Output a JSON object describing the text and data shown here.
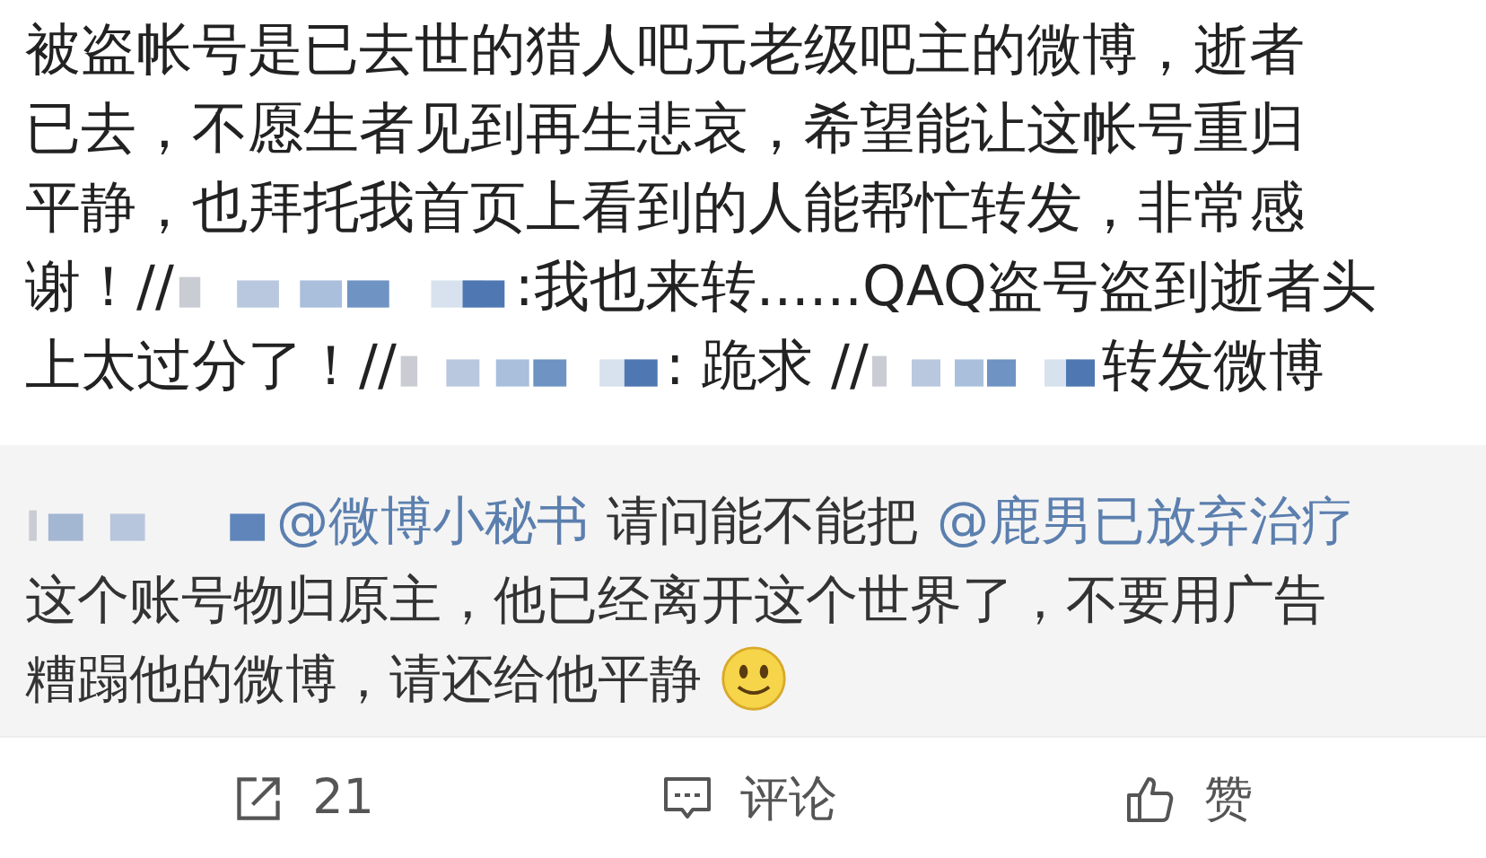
{
  "post": {
    "lines": [
      [
        {
          "kind": "text",
          "text": "被盗帐号是已去世的猎人吧元老级吧主的微博，逝者"
        }
      ],
      [
        {
          "kind": "text",
          "text": "已去，不愿生者见到再生悲哀，希望能让这帐号重归"
        }
      ],
      [
        {
          "kind": "text",
          "text": "平静，也拜托我首页上看到的人能帮忙转发，非常感"
        }
      ],
      [
        {
          "kind": "text",
          "text": "谢！//"
        },
        {
          "kind": "mosaic"
        },
        {
          "kind": "text",
          "text": ":我也来转......QAQ盗号盗到逝者头"
        }
      ],
      [
        {
          "kind": "text",
          "text": "上太过分了！//"
        },
        {
          "kind": "mosaic"
        },
        {
          "kind": "text",
          "text": ": 跪求 //"
        },
        {
          "kind": "mosaic"
        },
        {
          "kind": "text",
          "text": "转发微博"
        }
      ]
    ]
  },
  "comment": {
    "lines": [
      [
        {
          "kind": "mosaic"
        },
        {
          "kind": "mention",
          "text": "@微博小秘书"
        },
        {
          "kind": "text",
          "text": "请问能不能把"
        },
        {
          "kind": "mention",
          "text": "@鹿男已放弃治疗"
        }
      ],
      [
        {
          "kind": "text",
          "text": "这个账号物归原主，他已经离开这个世界了，不要用广告"
        }
      ],
      [
        {
          "kind": "text",
          "text": "糟蹋他的微博，请还给他平静"
        },
        {
          "kind": "emoji"
        }
      ]
    ]
  },
  "actions": [
    {
      "kind": "repost",
      "label": "21"
    },
    {
      "kind": "comment",
      "label": "评论"
    },
    {
      "kind": "like",
      "label": "赞"
    }
  ]
}
